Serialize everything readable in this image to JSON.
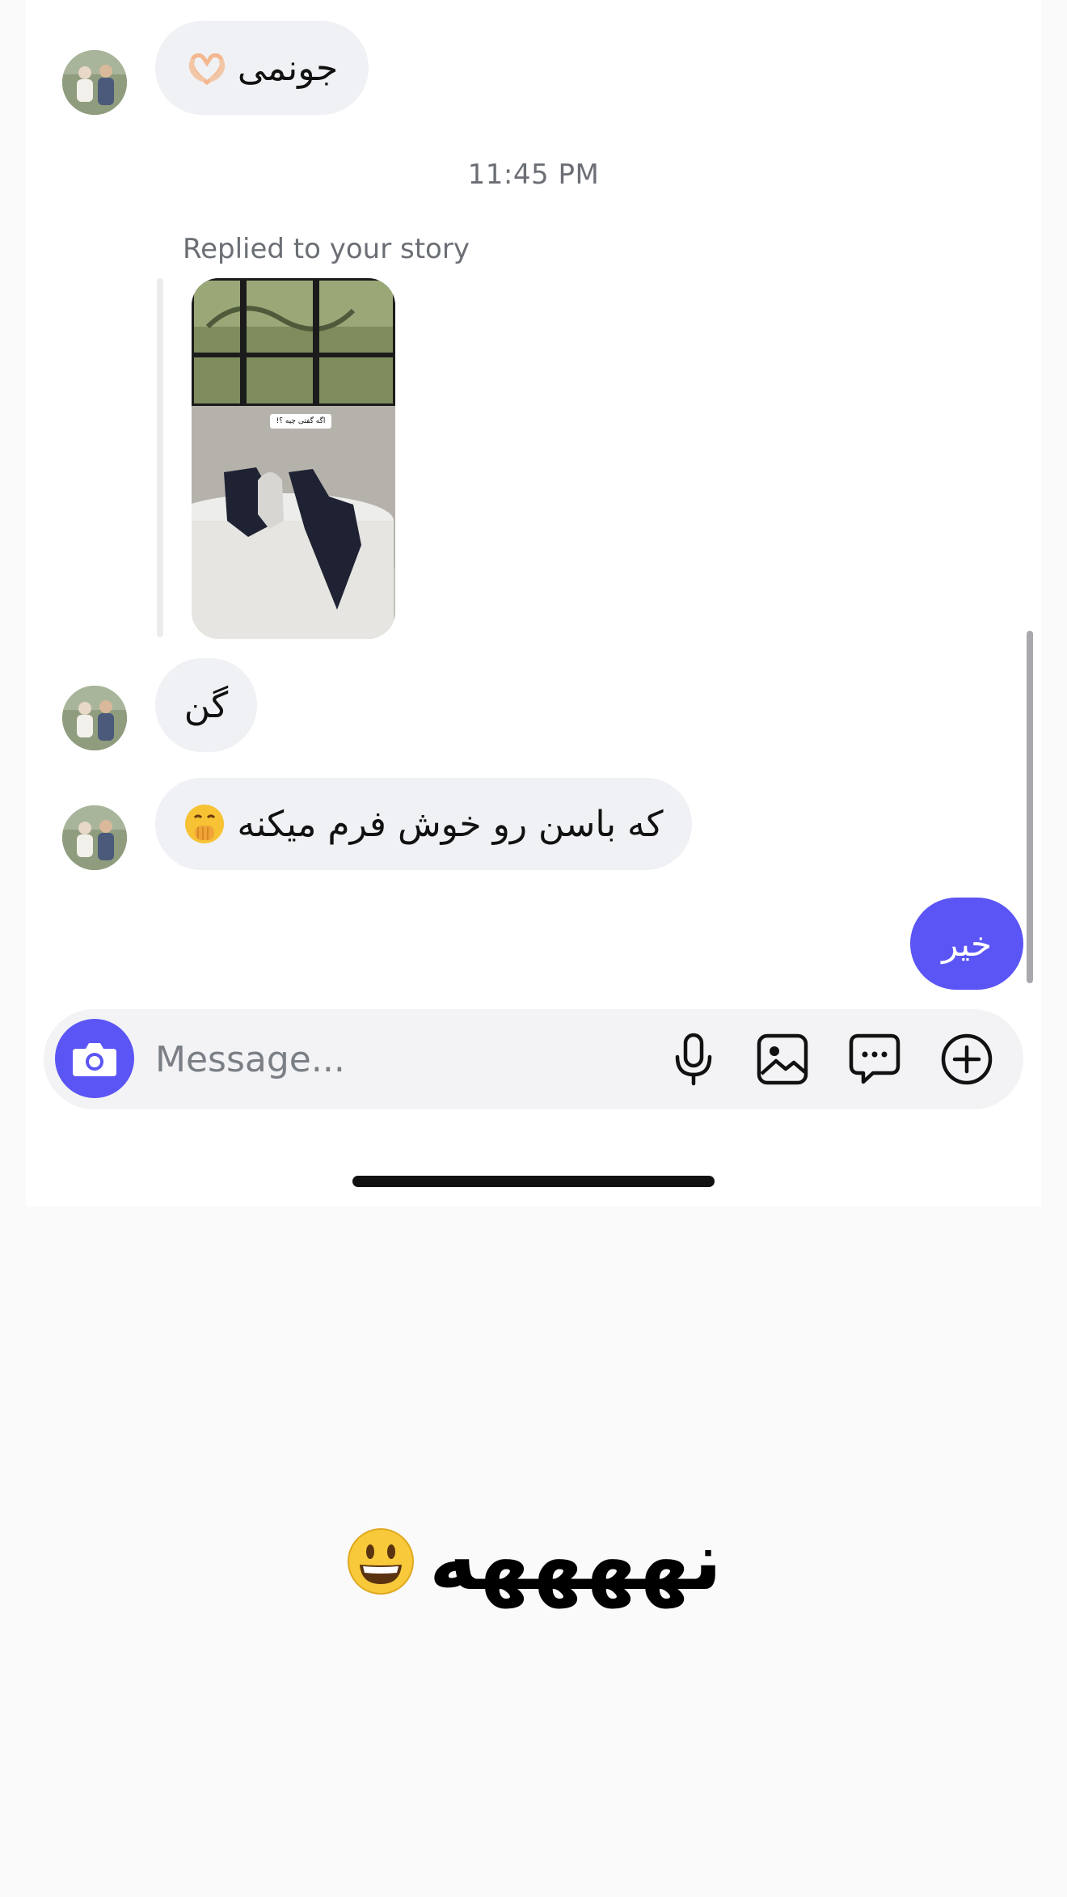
{
  "thread": {
    "messages": [
      {
        "text": "جونمی",
        "emoji": "heart-hands-emoji",
        "sender": "other"
      },
      {
        "text": "گن",
        "sender": "other"
      },
      {
        "text": "که باسن رو خوش فرم میکنه",
        "emoji": "hand-over-mouth-emoji",
        "sender": "other"
      },
      {
        "text": "خیر",
        "sender": "me"
      }
    ],
    "timestamp": "11:45 PM",
    "reply_label": "Replied to your story",
    "story_sticker_text": "اگه گفتی چیه ؟!"
  },
  "composer": {
    "placeholder": "Message...",
    "icons": [
      "camera-icon",
      "microphone-icon",
      "gallery-icon",
      "sticker-icon",
      "plus-icon"
    ]
  },
  "caption": {
    "text": "نههههه",
    "emoji": "grinning-face-emoji"
  },
  "colors": {
    "accent": "#5b55f5",
    "incoming_bubble": "#f0f1f4",
    "page_background": "#fafafa"
  }
}
